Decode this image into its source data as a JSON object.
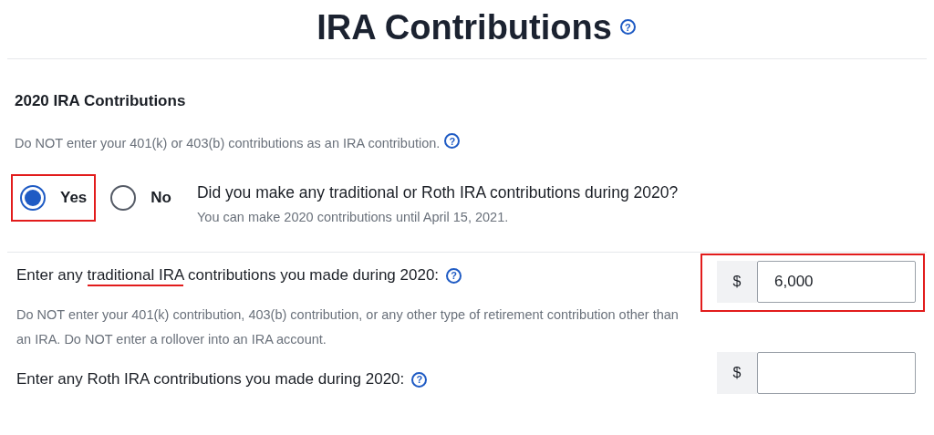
{
  "page": {
    "title": "IRA Contributions",
    "help": "?"
  },
  "section": {
    "heading": "2020 IRA Contributions",
    "note": "Do NOT enter your 401(k) or 403(b) contributions as an IRA contribution.",
    "help": "?"
  },
  "question": {
    "options": [
      {
        "label": "Yes",
        "selected": true,
        "highlighted": true
      },
      {
        "label": "No",
        "selected": false,
        "highlighted": false
      }
    ],
    "text": "Did you make any traditional or Roth IRA contributions during 2020?",
    "hint": "You can make 2020 contributions until April 15, 2021."
  },
  "fields": [
    {
      "label": [
        {
          "text": "Enter any ",
          "underlined": false
        },
        {
          "text": "traditional IRA",
          "underlined": true
        },
        {
          "text": " contributions you made during 2020:",
          "underlined": false
        }
      ],
      "help": "?",
      "prefix": "$",
      "value": "6,000",
      "highlighted": true,
      "note": "Do NOT enter your 401(k) contribution, 403(b) contribution, or any other type of retirement contribution other than an IRA. Do NOT enter a rollover into an IRA account."
    },
    {
      "label": [
        {
          "text": "Enter any Roth IRA contributions you made during 2020:",
          "underlined": false
        }
      ],
      "help": "?",
      "prefix": "$",
      "highlighted": false
    }
  ]
}
